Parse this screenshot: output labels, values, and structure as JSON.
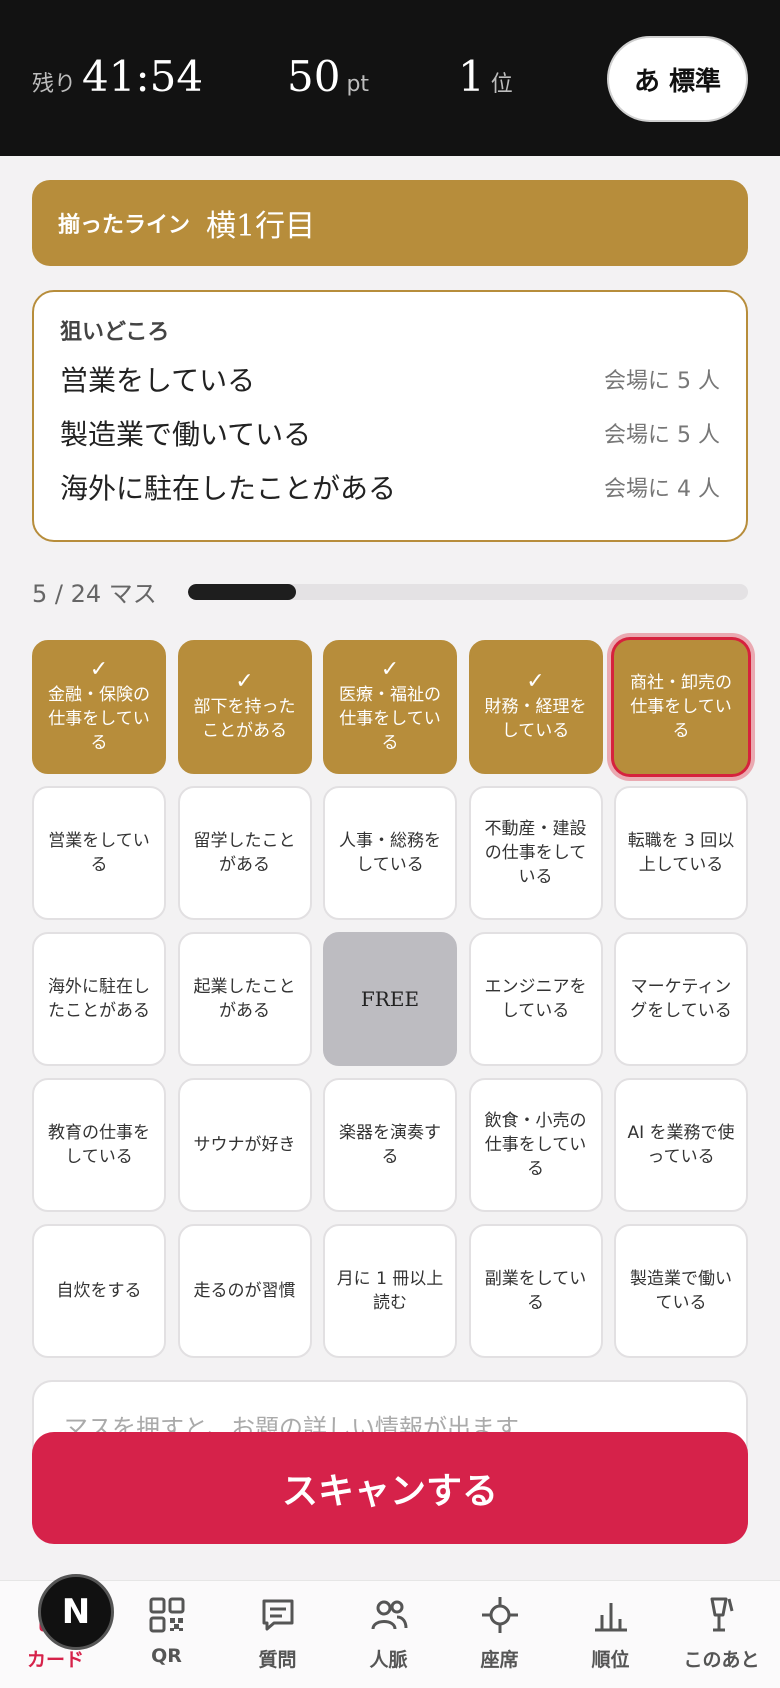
{
  "header": {
    "remaining_label": "残り",
    "remaining_time": "41:54",
    "points_value": "50",
    "points_unit": "pt",
    "rank_value": "1",
    "rank_unit": "位",
    "text_size_button": "あ 標準"
  },
  "line_banner": {
    "label": "揃ったライン",
    "value": "横1行目"
  },
  "targets": {
    "title": "狙いどころ",
    "items": [
      {
        "text": "営業をしている",
        "count": "会場に 5 人"
      },
      {
        "text": "製造業で働いている",
        "count": "会場に 5 人"
      },
      {
        "text": "海外に駐在したことがある",
        "count": "会場に 4 人"
      }
    ]
  },
  "progress": {
    "label": "5 / 24 マス",
    "fraction": 0.192
  },
  "grid": {
    "check_glyph": "✓",
    "cells": [
      {
        "text": "金融・保険の仕事をしている",
        "marked": true
      },
      {
        "text": "部下を持ったことがある",
        "marked": true
      },
      {
        "text": "医療・福祉の仕事をしている",
        "marked": true
      },
      {
        "text": "財務・経理をしている",
        "marked": true
      },
      {
        "text": "商社・卸売の仕事をしている",
        "selected": true
      },
      {
        "text": "営業をしている"
      },
      {
        "text": "留学したことがある"
      },
      {
        "text": "人事・総務をしている"
      },
      {
        "text": "不動産・建設の仕事をしている"
      },
      {
        "text": "転職を 3 回以上している"
      },
      {
        "text": "海外に駐在したことがある"
      },
      {
        "text": "起業したことがある"
      },
      {
        "text": "FREE",
        "free": true
      },
      {
        "text": "エンジニアをしている"
      },
      {
        "text": "マーケティングをしている"
      },
      {
        "text": "教育の仕事をしている"
      },
      {
        "text": "サウナが好き"
      },
      {
        "text": "楽器を演奏する"
      },
      {
        "text": "飲食・小売の仕事をしている"
      },
      {
        "text": "AI を業務で使っている"
      },
      {
        "text": "自炊をする"
      },
      {
        "text": "走るのが習慣"
      },
      {
        "text": "月に 1 冊以上読む"
      },
      {
        "text": "副業をしている"
      },
      {
        "text": "製造業で働いている"
      }
    ]
  },
  "hint": {
    "text": "マスを押すと、お題の詳しい情報が出ます"
  },
  "scan_button": {
    "label": "スキャンする"
  },
  "badge": {
    "letter": "N"
  },
  "nav": {
    "items": [
      {
        "label": "カード",
        "icon": "grid-icon",
        "active": true
      },
      {
        "label": "QR",
        "icon": "qr-icon"
      },
      {
        "label": "質問",
        "icon": "chat-icon"
      },
      {
        "label": "人脈",
        "icon": "people-icon"
      },
      {
        "label": "座席",
        "icon": "crosshair-icon"
      },
      {
        "label": "順位",
        "icon": "chart-icon"
      },
      {
        "label": "このあと",
        "icon": "drink-icon"
      }
    ]
  },
  "colors": {
    "accent_gold": "#b78d3b",
    "accent_red": "#d6224a",
    "header_bg": "#121212"
  }
}
